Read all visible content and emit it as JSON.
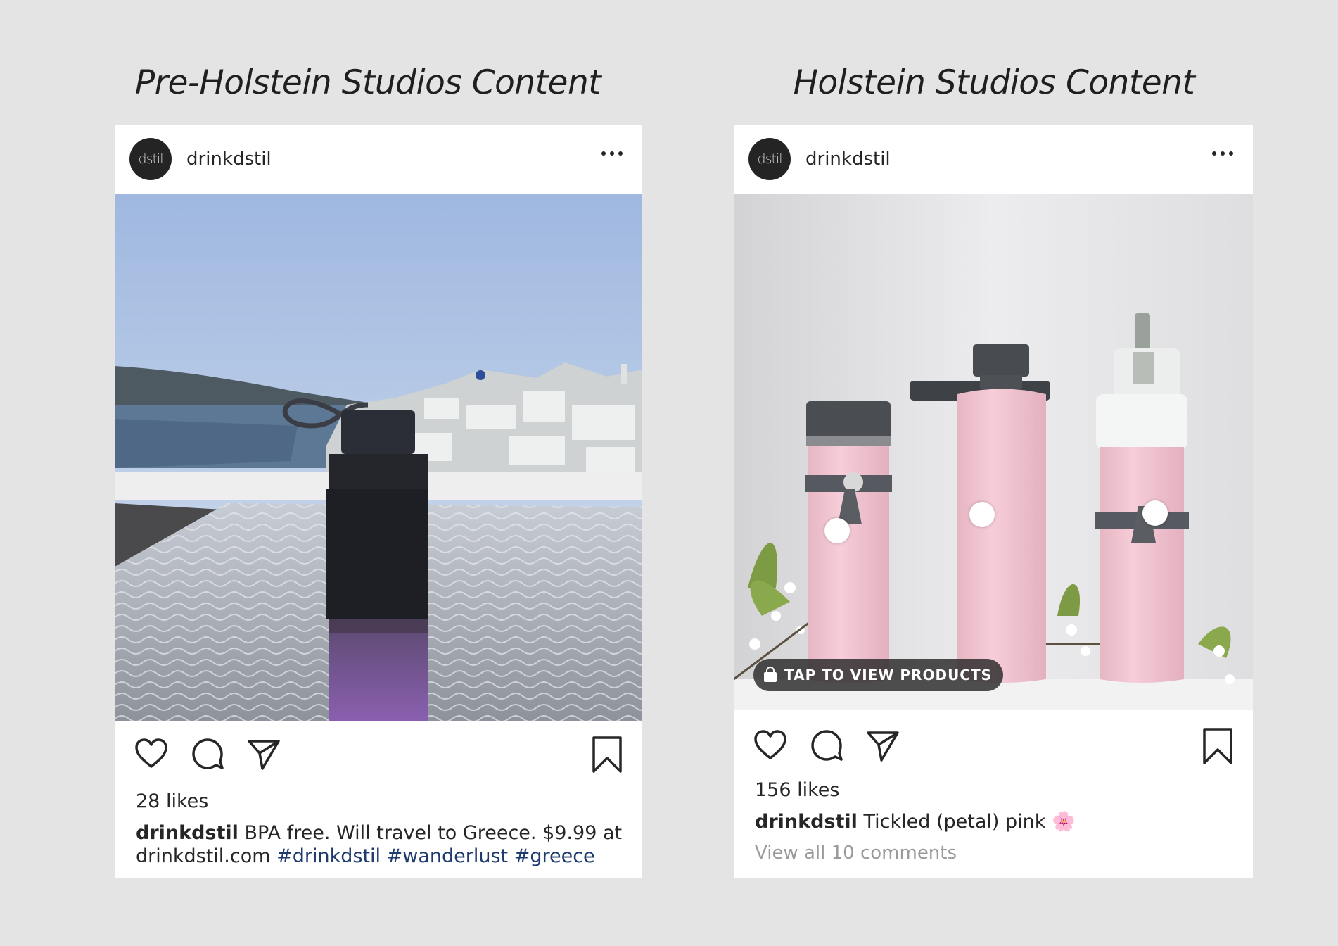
{
  "headings": {
    "left": "Pre-Holstein Studios Content",
    "right": "Holstein Studios Content"
  },
  "posts": [
    {
      "avatar_text": "dstil",
      "username": "drinkdstil",
      "likes": "28 likes",
      "caption_user": "drinkdstil",
      "caption_text": "BPA free. Will travel to Greece. $9.99 at drinkdstil.com",
      "hashtags": [
        "#drinkdstil",
        "#wanderlust",
        "#greece"
      ]
    },
    {
      "avatar_text": "dstil",
      "username": "drinkdstil",
      "likes": "156 likes",
      "caption_user": "drinkdstil",
      "caption_text": "Tickled (petal) pink",
      "caption_emoji": "🌸",
      "comments_link": "View all 10 comments",
      "tap_label": "TAP TO VIEW PRODUCTS"
    }
  ],
  "icons": [
    "more-icon",
    "heart-icon",
    "comment-icon",
    "share-icon",
    "bookmark-icon",
    "shopping-bag-icon"
  ],
  "colors": {
    "background": "#e4e4e4",
    "card": "#ffffff",
    "text": "#262626",
    "hashtag": "#1f3a6e",
    "muted": "#9a9a9a"
  }
}
